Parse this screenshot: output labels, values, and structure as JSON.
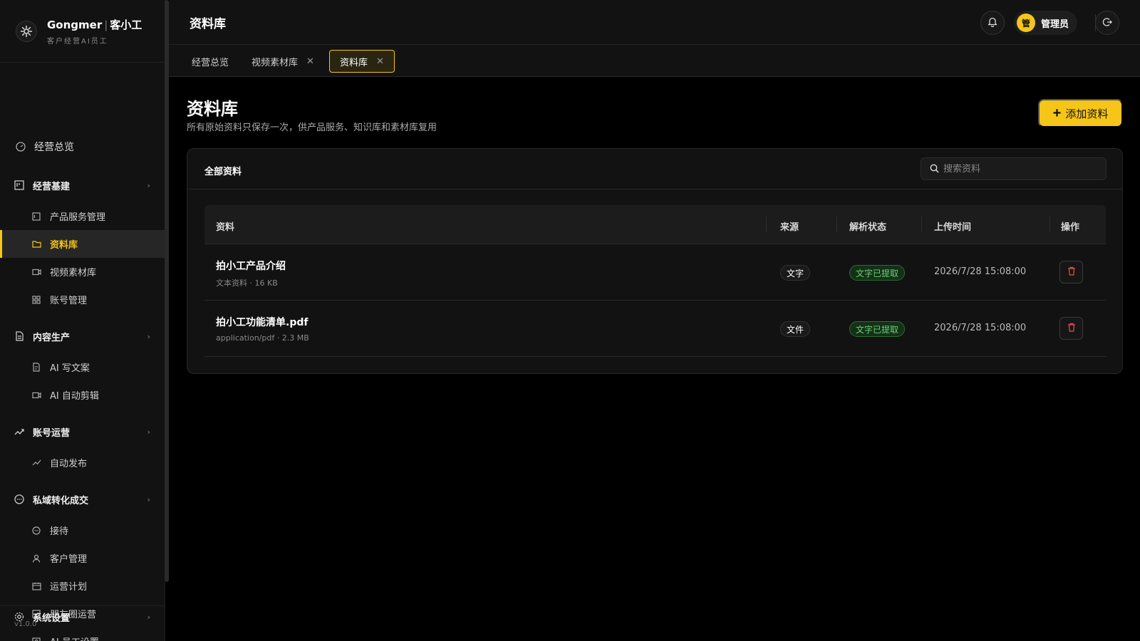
{
  "brand": {
    "name": "Gongmer",
    "separator": "|",
    "name_cn": "客小工",
    "subtitle": "客户经营AI员工"
  },
  "sidebar": {
    "overview": "经营总览",
    "groups": [
      {
        "label": "经营基建",
        "items": [
          "产品服务管理",
          "资料库",
          "视频素材库",
          "账号管理"
        ]
      },
      {
        "label": "内容生产",
        "items": [
          "AI 写文案",
          "AI 自动剪辑"
        ]
      },
      {
        "label": "账号运营",
        "items": [
          "自动发布"
        ]
      },
      {
        "label": "私域转化成交",
        "items": [
          "接待",
          "客户管理",
          "运营计划",
          "朋友圈运营",
          "AI 员工设置"
        ]
      }
    ],
    "settings": "系统设置",
    "version": "v1.0.0",
    "active_item": "资料库"
  },
  "header": {
    "title": "资料库",
    "user_avatar_char": "管",
    "user_name": "管理员"
  },
  "tabs": [
    {
      "label": "经营总览",
      "closable": false
    },
    {
      "label": "视频素材库",
      "closable": true
    },
    {
      "label": "资料库",
      "closable": true,
      "active": true
    }
  ],
  "page": {
    "title": "资料库",
    "subtitle": "所有原始资料只保存一次，供产品服务、知识库和素材库复用",
    "add_button": "添加资料"
  },
  "card": {
    "title": "全部资料",
    "search_placeholder": "搜索资料",
    "columns": [
      "资料",
      "来源",
      "解析状态",
      "上传时间",
      "操作"
    ],
    "rows": [
      {
        "name": "拍小工产品介绍",
        "meta": "文本资料 · 16 KB",
        "source": "文字",
        "status": "文字已提取",
        "time": "2026/7/28 15:08:00"
      },
      {
        "name": "拍小工功能清单.pdf",
        "meta": "application/pdf · 2.3 MB",
        "source": "文件",
        "status": "文字已提取",
        "time": "2026/7/28 15:08:00"
      }
    ]
  },
  "colors": {
    "accent": "#f5c518",
    "status_green": "#6ccf77",
    "background": "#000000",
    "panel": "#121212"
  }
}
